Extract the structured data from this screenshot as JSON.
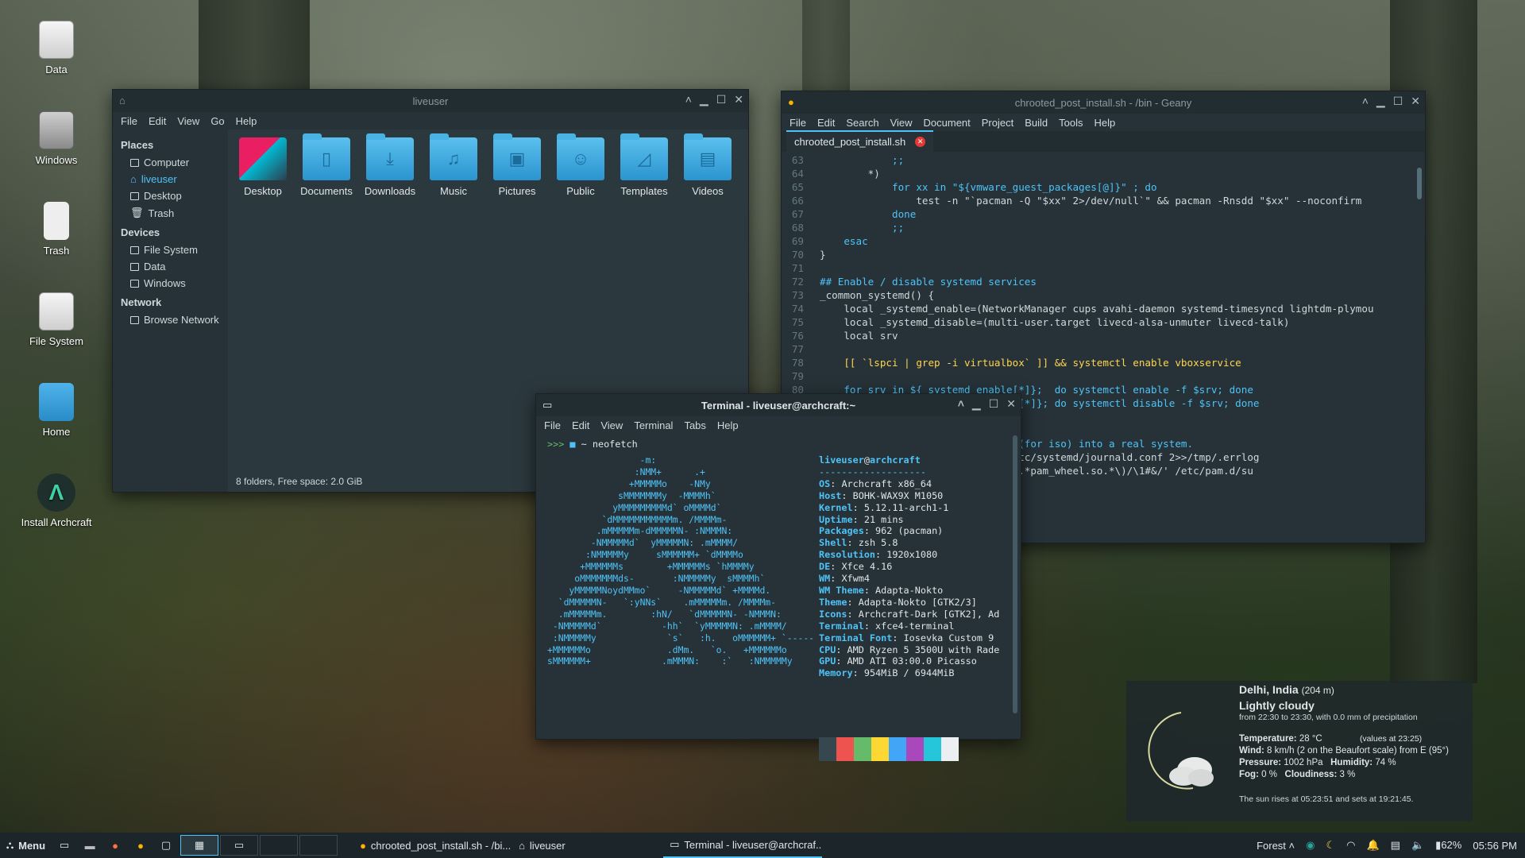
{
  "desktop_icons": [
    {
      "label": "Data",
      "icon": "drive-icon"
    },
    {
      "label": "Windows",
      "icon": "drive-icon"
    },
    {
      "label": "Trash",
      "icon": "trash-icon"
    },
    {
      "label": "File System",
      "icon": "drive-icon"
    },
    {
      "label": "Home",
      "icon": "home-folder-icon"
    },
    {
      "label": "Install Archcraft",
      "icon": "archcraft-icon"
    }
  ],
  "file_manager": {
    "title": "liveuser",
    "menu": [
      "File",
      "Edit",
      "View",
      "Go",
      "Help"
    ],
    "sidebar": {
      "places_header": "Places",
      "places": [
        "Computer",
        "liveuser",
        "Desktop",
        "Trash"
      ],
      "devices_header": "Devices",
      "devices": [
        "File System",
        "Data",
        "Windows"
      ],
      "network_header": "Network",
      "network": [
        "Browse Network"
      ]
    },
    "folders": [
      "Desktop",
      "Documents",
      "Downloads",
      "Music",
      "Pictures",
      "Public",
      "Templates",
      "Videos"
    ],
    "status": "8 folders, Free space: 2.0 GiB"
  },
  "geany": {
    "title": "chrooted_post_install.sh - /bin - Geany",
    "menu": [
      "File",
      "Edit",
      "Search",
      "View",
      "Document",
      "Project",
      "Build",
      "Tools",
      "Help"
    ],
    "tab": "chrooted_post_install.sh",
    "lines": [
      {
        "n": "63",
        "t": "            ;;"
      },
      {
        "n": "64",
        "t": "        *)"
      },
      {
        "n": "65",
        "t": "            for xx in \"${vmware_guest_packages[@]}\" ; do"
      },
      {
        "n": "66",
        "t": "                test -n \"`pacman -Q \"$xx\" 2>/dev/null`\" && pacman -Rnsdd \"$xx\" --noconfirm"
      },
      {
        "n": "67",
        "t": "            done"
      },
      {
        "n": "68",
        "t": "            ;;"
      },
      {
        "n": "69",
        "t": "    esac"
      },
      {
        "n": "70",
        "t": "}"
      },
      {
        "n": "71",
        "t": ""
      },
      {
        "n": "72",
        "t": "## Enable / disable systemd services"
      },
      {
        "n": "73",
        "t": "_common_systemd() {"
      },
      {
        "n": "74",
        "t": "    local _systemd_enable=(NetworkManager cups avahi-daemon systemd-timesyncd lightdm-plymou"
      },
      {
        "n": "75",
        "t": "    local _systemd_disable=(multi-user.target livecd-alsa-unmuter livecd-talk)"
      },
      {
        "n": "76",
        "t": "    local srv"
      },
      {
        "n": "77",
        "t": ""
      },
      {
        "n": "78",
        "t": "    [[ `lspci | grep -i virtualbox` ]] && systemctl enable vboxservice"
      },
      {
        "n": "79",
        "t": ""
      },
      {
        "n": "80",
        "t": "    for srv in ${_systemd_enable[*]};  do systemctl enable -f $srv; done"
      },
      {
        "n": "81",
        "t": "    for srv in ${_systemd_disable[*]}; do systemctl disable -f $srv; done"
      },
      {
        "n": "82",
        "t": "}"
      },
      {
        "n": "83",
        "t": ""
      },
      {
        "n": "84",
        "t": "## Fix journald: Change volatile (for iso) into a real system."
      },
      {
        "n": "85",
        "t": "    sed -i 's/volatile/auto/g' /etc/systemd/journald.conf 2>>/tmp/.errlog"
      },
      {
        "n": "86",
        "t": "    sed -i 's/^#auth/auth/;s/^#\\(.*pam_wheel.so.*\\)/\\1#&/' /etc/pam.d/su"
      }
    ]
  },
  "terminal": {
    "title": "Terminal - liveuser@archcraft:~",
    "menu": [
      "File",
      "Edit",
      "View",
      "Terminal",
      "Tabs",
      "Help"
    ],
    "prompt_arrows": ">>>",
    "prompt_path": "~",
    "command": "neofetch",
    "user_host_user": "liveuser",
    "user_host_host": "archcraft",
    "separator": "-------------------",
    "info": [
      {
        "k": "OS",
        "v": "Archcraft x86_64"
      },
      {
        "k": "Host",
        "v": "BOHK-WAX9X M1050"
      },
      {
        "k": "Kernel",
        "v": "5.12.11-arch1-1"
      },
      {
        "k": "Uptime",
        "v": "21 mins"
      },
      {
        "k": "Packages",
        "v": "962 (pacman)"
      },
      {
        "k": "Shell",
        "v": "zsh 5.8"
      },
      {
        "k": "Resolution",
        "v": "1920x1080"
      },
      {
        "k": "DE",
        "v": "Xfce 4.16"
      },
      {
        "k": "WM",
        "v": "Xfwm4"
      },
      {
        "k": "WM Theme",
        "v": "Adapta-Nokto"
      },
      {
        "k": "Theme",
        "v": "Adapta-Nokto [GTK2/3]"
      },
      {
        "k": "Icons",
        "v": "Archcraft-Dark [GTK2], Ad"
      },
      {
        "k": "Terminal",
        "v": "xfce4-terminal"
      },
      {
        "k": "Terminal Font",
        "v": "Iosevka Custom 9"
      },
      {
        "k": "CPU",
        "v": "AMD Ryzen 5 3500U with Rade"
      },
      {
        "k": "GPU",
        "v": "AMD ATI 03:00.0 Picasso"
      },
      {
        "k": "Memory",
        "v": "954MiB / 6944MiB"
      }
    ],
    "ascii_art": [
      "                 -m:",
      "                :NMM+      .+",
      "               +MMMMMo    -NMy",
      "             sMMMMMMMy  -MMMMh`",
      "            yMMMMMMMMMd` oMMMMd`",
      "          `dMMMMMMMMMMMm. /MMMMm-",
      "         .mMMMMMm-dMMMMMN- :NMMMN:",
      "        -NMMMMMd`  yMMMMMN: .mMMMM/",
      "       :NMMMMMy     sMMMMMM+ `dMMMMo",
      "      +MMMMMMs        +MMMMMMs `hMMMMy",
      "     oMMMMMMMds-       :NMMMMMy  sMMMMh`",
      "    yMMMMMNoydMMmo`     -NMMMMMd` +MMMMd.",
      "  `dMMMMMN-   `:yNNs`    .mMMMMMm. /MMMMm-",
      "  .mMMMMMm.        :hN/   `dMMMMMN- -NMMMN:",
      " -NMMMMMd`           -hh`  `yMMMMMN: .mMMMM/",
      " :NMMMMMy             `s`   :h.   oMMMMMM+ `-----",
      "+MMMMMMo              .dMm.   `o.   +MMMMMMo",
      "sMMMMMM+             .mMMMN:    :`   :NMMMMMy"
    ],
    "swatch_colors": [
      "#37474f",
      "#ef5350",
      "#66bb6a",
      "#fdd835",
      "#42a5f5",
      "#ab47bc",
      "#26c6da",
      "#eceff1"
    ]
  },
  "weather": {
    "city": "Delhi, India",
    "altitude": "(204 m)",
    "condition": "Lightly cloudy",
    "forecast": "from 22:30 to 23:30, with 0.0 mm of precipitation",
    "temperature_label": "Temperature:",
    "temperature": "28 °C",
    "values_at": "(values at 23:25)",
    "wind_label": "Wind:",
    "wind": "8 km/h (2 on the Beaufort scale) from E (95°)",
    "pressure_label": "Pressure:",
    "pressure": "1002 hPa",
    "humidity_label": "Humidity:",
    "humidity": "74 %",
    "fog_label": "Fog:",
    "fog": "0 %",
    "cloudiness_label": "Cloudiness:",
    "cloudiness": "3 %",
    "sun": "The sun rises at 05:23:51 and sets at 19:21:45."
  },
  "taskbar": {
    "menu_label": "Menu",
    "tasks": [
      "chrooted_post_install.sh - /bi...",
      "liveuser",
      "Terminal - liveuser@archcraf..."
    ],
    "forest_label": "Forest",
    "battery": "62%",
    "clock": "05:56 PM"
  },
  "colors": {
    "accent": "#4fc3f7",
    "window_bg": "#263238",
    "titlebar_bg": "#222d32"
  }
}
